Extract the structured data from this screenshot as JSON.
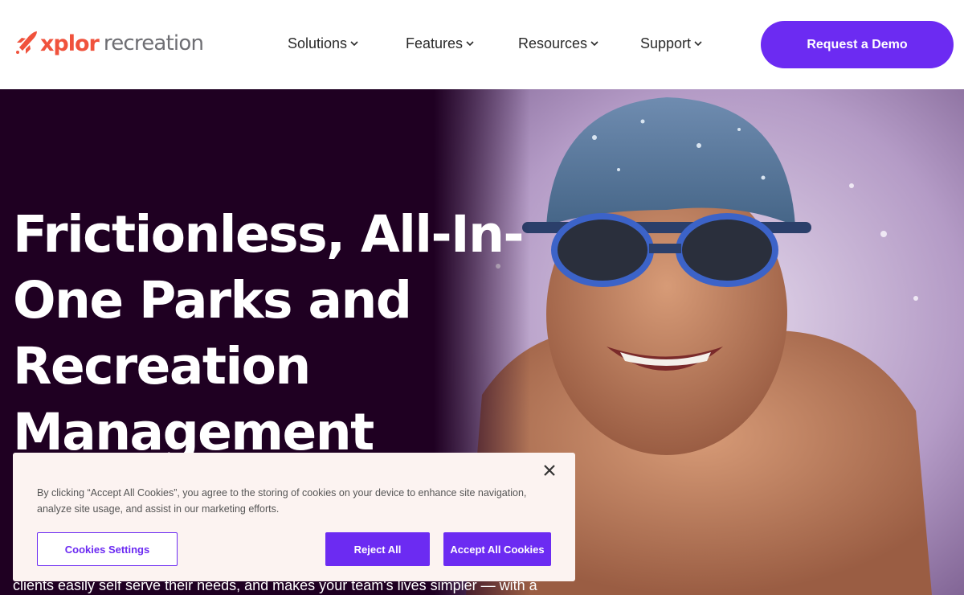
{
  "header": {
    "logo": {
      "brand": "xplor",
      "product": "recreation",
      "icon": "rocket-icon"
    },
    "nav": [
      {
        "label": "Solutions"
      },
      {
        "label": "Features"
      },
      {
        "label": "Resources"
      },
      {
        "label": "Support"
      }
    ],
    "cta_label": "Request a Demo"
  },
  "hero": {
    "title": "Frictionless, All-In-One Parks and Recreation Management",
    "subtitle": "clients easily self serve their needs, and makes your team's lives simpler — with a",
    "image": "smiling-swimmer-photo"
  },
  "cookie_banner": {
    "text": "By clicking “Accept All Cookies”, you agree to the storing of cookies on your device to enhance site navigation, analyze site usage, and assist in our marketing efforts.",
    "settings_label": "Cookies Settings",
    "reject_label": "Reject All",
    "accept_label": "Accept All Cookies"
  },
  "colors": {
    "accent": "#6c2bf2",
    "logo_orange": "#f0523c",
    "hero_bg": "#1f0022",
    "banner_bg": "#fcf3f1"
  }
}
